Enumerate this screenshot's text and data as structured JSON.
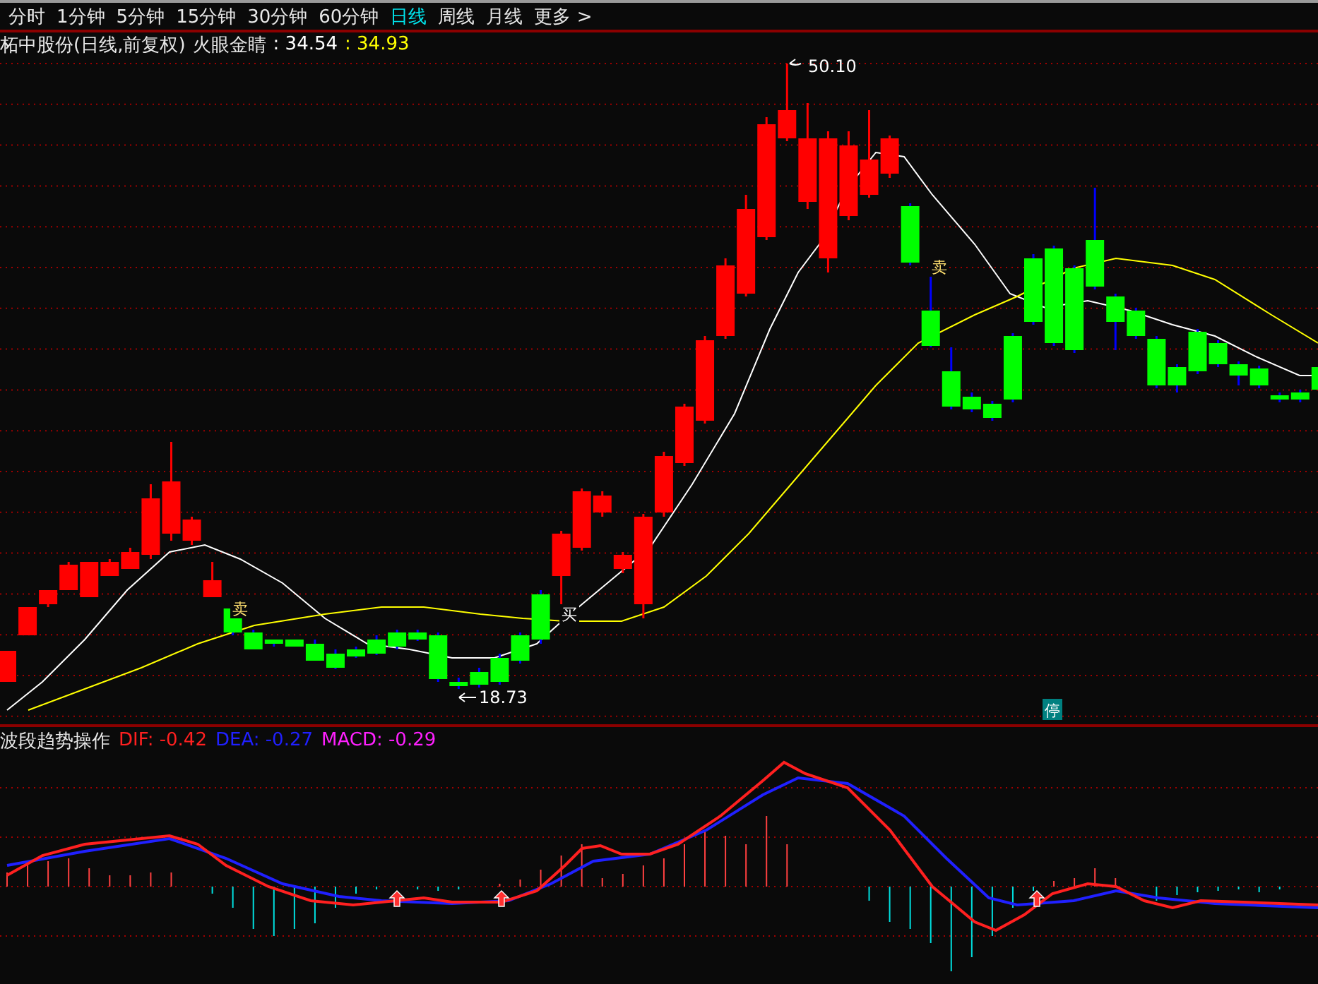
{
  "tabs": [
    {
      "label": "分时",
      "selected": false
    },
    {
      "label": "1分钟",
      "selected": false
    },
    {
      "label": "5分钟",
      "selected": false
    },
    {
      "label": "15分钟",
      "selected": false
    },
    {
      "label": "30分钟",
      "selected": false
    },
    {
      "label": "60分钟",
      "selected": false
    },
    {
      "label": "日线",
      "selected": true
    },
    {
      "label": "周线",
      "selected": false
    },
    {
      "label": "月线",
      "selected": false
    },
    {
      "label": "更多 >",
      "selected": false
    }
  ],
  "price_chart": {
    "stock": "柘中股份(日线,前复权)",
    "indicator": "火眼金睛",
    "values": [
      {
        "text": ": 34.54",
        "color": "#ffffff"
      },
      {
        "text": ": 34.93",
        "color": "#ffff00"
      }
    ],
    "markers": [
      {
        "kind": "high",
        "text": "50.10"
      },
      {
        "kind": "low",
        "text": "18.73"
      },
      {
        "kind": "sell",
        "text": "卖"
      },
      {
        "kind": "sell",
        "text": "卖"
      },
      {
        "kind": "buy",
        "text": "买"
      },
      {
        "kind": "halt",
        "text": "停"
      }
    ]
  },
  "macd_panel": {
    "name": "波段趋势操作",
    "values": [
      {
        "text": "DIF: -0.42",
        "color": "#ff2020"
      },
      {
        "text": "DEA: -0.27",
        "color": "#2020ff"
      },
      {
        "text": "MACD: -0.29",
        "color": "#ff20ff"
      }
    ]
  }
}
